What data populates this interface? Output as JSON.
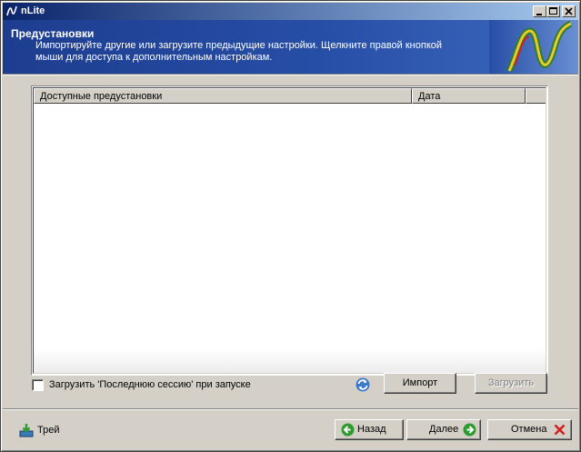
{
  "window": {
    "title": "nLite"
  },
  "header": {
    "title": "Предустановки",
    "description": "Импортируйте другие или загрузите предыдущие настройки. Щелкните правой кнопкой мыши для доступа к дополнительным настройкам."
  },
  "list": {
    "columns": [
      "Доступные предустановки",
      "Дата"
    ],
    "rows": []
  },
  "options": {
    "load_last_session_label": "Загрузить 'Последнюю сессию' при запуске",
    "load_last_session_checked": false
  },
  "buttons": {
    "import_label": "Импорт",
    "load_label": "Загрузить",
    "tray_label": "Трей",
    "back_label": "Назад",
    "next_label": "Далее",
    "cancel_label": "Отмена"
  },
  "icons": {
    "refresh": "refresh-icon",
    "tray": "tray-icon",
    "back": "back-arrow-icon",
    "next": "next-arrow-icon",
    "cancel": "cancel-x-icon"
  },
  "colors": {
    "header_bg": "#274ea6",
    "titlebar_start": "#0a246a",
    "titlebar_end": "#a6caf0",
    "nav_green": "#2f9a2f",
    "cancel_red": "#d42020"
  }
}
